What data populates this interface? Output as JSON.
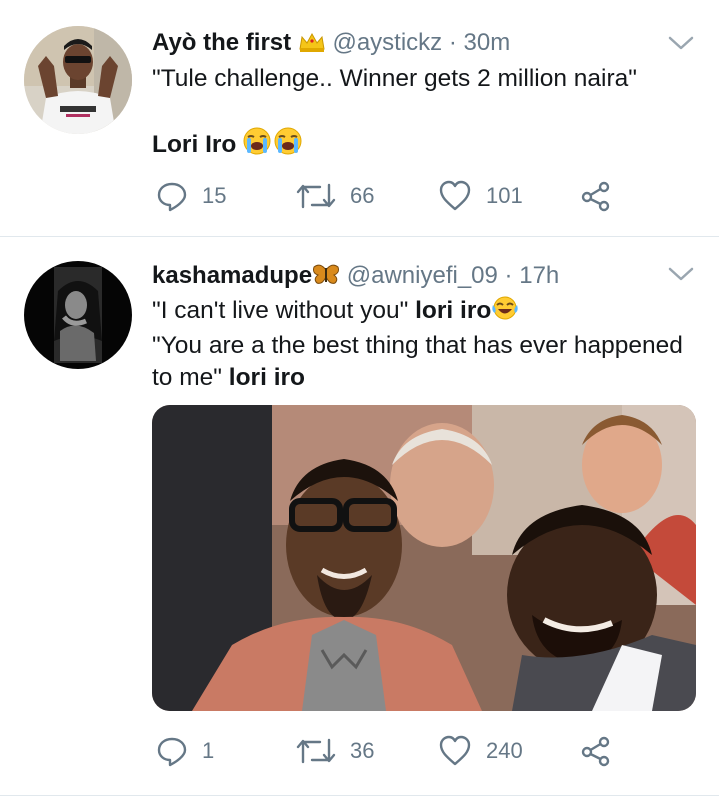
{
  "tweets": [
    {
      "author_name": "Ayò the first",
      "author_badge": "crown",
      "handle": "@aystickz",
      "separator": "·",
      "time": "30m",
      "line1": "\"Tule challenge.. Winner gets 2 million naira\"",
      "line2_bold": "Lori Iro",
      "line2_emoji": "loudly-crying-face",
      "reply_count": "15",
      "retweet_count": "66",
      "like_count": "101"
    },
    {
      "author_name": "kashamadupe",
      "author_badge": "butterfly",
      "handle": "@awniyefi_09",
      "separator": "·",
      "time": "17h",
      "line1_text": "\"I can't live without you\" ",
      "line1_bold": "lori iro",
      "line1_emoji": "face-with-tears-of-joy",
      "line2_text": "\"You are a the best thing that has ever happened",
      "line3_text": "to me\" ",
      "line3_bold": "lori iro",
      "reply_count": "1",
      "retweet_count": "36",
      "like_count": "240",
      "media": "photo"
    }
  ],
  "colors": {
    "text": "#14171a",
    "secondary": "#657786",
    "divider": "#e1e8ed",
    "background": "#ffffff"
  }
}
